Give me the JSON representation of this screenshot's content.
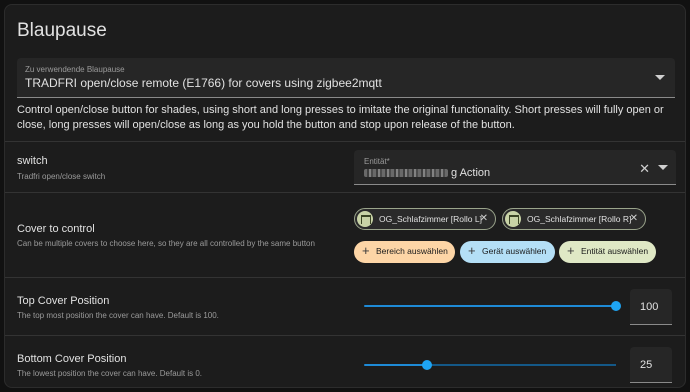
{
  "title": "Blaupause",
  "blueprint_select": {
    "label": "Zu verwendende Blaupause",
    "value": "TRADFRI open/close remote (E1766) for covers using zigbee2mqtt"
  },
  "description": "Control open/close button for shades, using short and long presses to imitate the original functionality. Short presses will fully open or close, long presses will open/close as long as you hold the button and stop upon release of the button.",
  "switch_row": {
    "title": "switch",
    "subtitle": "Tradfri open/close switch",
    "entity_label": "Entität*",
    "entity_value_suffix": "g Action"
  },
  "cover_row": {
    "title": "Cover to control",
    "subtitle": "Can be multiple covers to choose here, so they are all controlled by the same button",
    "chips": [
      "OG_Schlafzimmer [Rollo L]",
      "OG_Schlafzimmer [Rollo R]"
    ],
    "add_area": "Bereich auswählen",
    "add_device": "Gerät auswählen",
    "add_entity": "Entität auswählen",
    "colors": {
      "area": "#fdd5a6",
      "device": "#b4dff6",
      "entity": "#dfe8c5"
    }
  },
  "top_cover": {
    "title": "Top Cover Position",
    "subtitle": "The top most position the cover can have. Default is 100.",
    "value": "100",
    "fraction": 1.0
  },
  "bottom_cover": {
    "title": "Bottom Cover Position",
    "subtitle": "The lowest position the cover can have. Default is 0.",
    "value": "25",
    "fraction": 0.25
  },
  "accent_color": "#1ea4f3"
}
